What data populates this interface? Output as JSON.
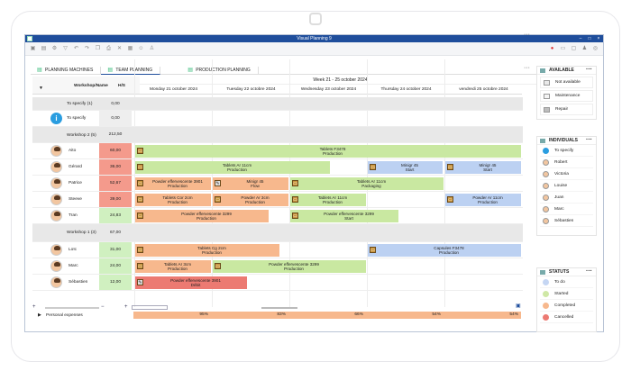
{
  "window": {
    "title": "Visual Planning 9"
  },
  "tabs": [
    {
      "label": "PLANNING MACHINES"
    },
    {
      "label": "TEAM PLANNING"
    },
    {
      "label": "PRODUCTION PLANNING"
    }
  ],
  "grid": {
    "week": "Week 21 - 25 october 2024",
    "col_workshop": "Workshop/Name",
    "col_hs": "H/S",
    "days": [
      "Monday 21 october 2024",
      "Tuesday 22 octobre 2024",
      "Wednesday 23 october 2024",
      "Thursday 24 october 2024",
      "vendredi 25 octobre 2024"
    ]
  },
  "rows": [
    {
      "name": "To specify (1)",
      "hs": "0,00"
    },
    {
      "name": "To specify",
      "hs": "0,00"
    },
    {
      "name": "Workshop 2 (5)",
      "hs": "212,50"
    },
    {
      "name": "Aito",
      "hs": "60,00"
    },
    {
      "name": "Gérard",
      "hs": "36,00"
    },
    {
      "name": "Patrice",
      "hs": "52,67"
    },
    {
      "name": "Steeve",
      "hs": "39,00"
    },
    {
      "name": "Tran",
      "hs": "24,83"
    },
    {
      "name": "Workshop 1 (3)",
      "hs": "67,00"
    },
    {
      "name": "Loïc",
      "hs": "31,00"
    },
    {
      "name": "Marc",
      "hs": "24,00"
    },
    {
      "name": "Sébastien",
      "hs": "12,00"
    }
  ],
  "tasks": [
    {
      "t1": "Tablets F3478",
      "t2": "Production"
    },
    {
      "t1": "Tablets Ar 11cm",
      "t2": "Production"
    },
    {
      "t1": "Minigr 45",
      "t2": "Start"
    },
    {
      "t1": "Minigr 45",
      "t2": "Start"
    },
    {
      "t1": "Powder effervescente 3901",
      "t2": "Production"
    },
    {
      "t1": "Minigr 45",
      "t2": "Flow"
    },
    {
      "t1": "Tablets Ar 11cm",
      "t2": "Packaging"
    },
    {
      "t1": "Tablets Cor 2cm",
      "t2": "Production"
    },
    {
      "t1": "Powder Ar 3cm",
      "t2": "Production"
    },
    {
      "t1": "Tablets Ar 11cm",
      "t2": "Production"
    },
    {
      "t1": "Powder Ar 11cm",
      "t2": "Production"
    },
    {
      "t1": "Powder effervescente 3299",
      "t2": "Production"
    },
    {
      "t1": "Powder effervescente 3299",
      "t2": "Start"
    },
    {
      "t1": "Tablets Cg 2cm",
      "t2": "Production"
    },
    {
      "t1": "Capsules F3478",
      "t2": "Production"
    },
    {
      "t1": "Tablets Ar 3cm",
      "t2": "Production"
    },
    {
      "t1": "Powder effervescente 3299",
      "t2": "Production"
    },
    {
      "t1": "Powder effervescente 3901",
      "t2": "Débit"
    }
  ],
  "personal_expenses": {
    "label": "Personal expenses",
    "values": [
      "95%",
      "83%",
      "66%",
      "54%",
      "54%"
    ]
  },
  "available": {
    "title": "AVAILABLE",
    "items": [
      {
        "label": "Not available",
        "color": "#e8e8e8"
      },
      {
        "label": "Maintenance",
        "color": "#f4f4f4"
      },
      {
        "label": "Repair",
        "color": "#bdbdbd"
      }
    ]
  },
  "individuals": {
    "title": "INDIVIDUALS",
    "items": [
      "To specify",
      "Robert",
      "Victoria",
      "Louise",
      "Juan",
      "Marc",
      "Sébastien"
    ]
  },
  "status": {
    "title": "STATUTS",
    "items": [
      {
        "label": "To do",
        "color": "#c5d6f3"
      },
      {
        "label": "Started",
        "color": "#cfe8a6"
      },
      {
        "label": "Completed",
        "color": "#f7b88d"
      },
      {
        "label": "Cancelled",
        "color": "#ec7a72"
      }
    ]
  }
}
